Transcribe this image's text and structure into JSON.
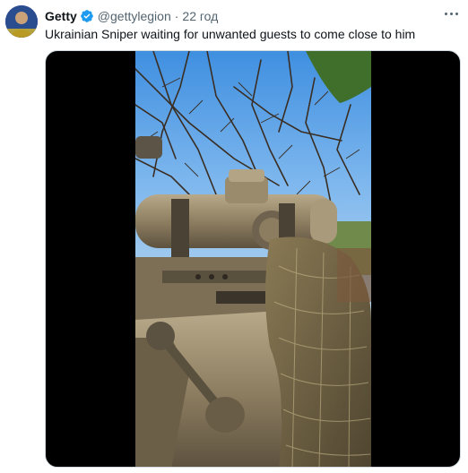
{
  "tweet": {
    "display_name": "Getty",
    "handle": "@gettylegion",
    "separator": "·",
    "time": "22 год",
    "text": "Ukrainian Sniper waiting for unwanted guests to come close to him"
  },
  "icons": {
    "verified": "verified-badge-icon",
    "more": "more-options-icon"
  },
  "colors": {
    "verified_blue": "#1d9bf0",
    "secondary_text": "#536471",
    "primary_text": "#0f1419",
    "media_background": "#000000"
  }
}
